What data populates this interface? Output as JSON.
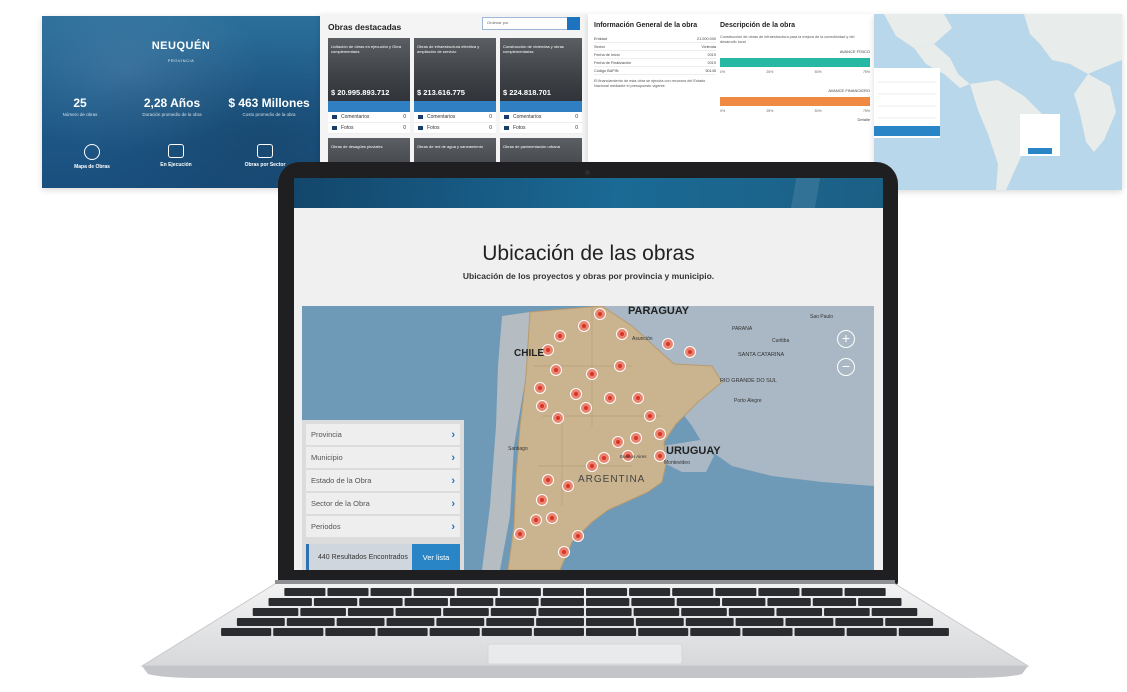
{
  "thumb_province": {
    "title": "NEUQUÉN",
    "subtitle": "PROVINCIA",
    "stats": [
      {
        "value": "25",
        "label": "Número de obras"
      },
      {
        "value": "2,28 Años",
        "label": "Duración promedio de la obra"
      },
      {
        "value": "$ 463 Millones",
        "label": "Costo promedio de la obra"
      }
    ],
    "nav": [
      "Mapa de Obras",
      "En Ejecución",
      "Obras por Sector"
    ]
  },
  "thumb_featured": {
    "title": "Obras destacadas",
    "order_placeholder": "Ordenar por",
    "cards": [
      {
        "text": "Licitación de obras en ejecución y Obra complementaria",
        "price": "$ 20.995.893.712"
      },
      {
        "text": "Obras de infraestructura eléctrica y ampliación de servicio",
        "price": "$ 213.616.775"
      },
      {
        "text": "Construcción de viviendas y obras complementarias",
        "price": "$ 224.818.701"
      }
    ],
    "row_labels": [
      "Comentarios",
      "Fotos"
    ],
    "row_counts": [
      "0",
      "0"
    ],
    "lower_cards": [
      "Obras de desagües pluviales",
      "Obras de red de agua y saneamiento",
      "Obras de pavimentación urbana"
    ]
  },
  "thumb_info": {
    "info_title": "Información General de la obra",
    "info_rows": [
      {
        "k": "Entidad",
        "v": "21.000.000"
      },
      {
        "k": "Sector",
        "v": "Vivienda"
      },
      {
        "k": "Fecha de Inicio",
        "v": "2019"
      },
      {
        "k": "Fecha de Finalización",
        "v": "2019"
      },
      {
        "k": "Código BAPIN",
        "v": "50145"
      }
    ],
    "info_note": "El financiamiento de esta obra se ejecuta con recursos del Estado Nacional mediante el presupuesto vigente",
    "desc_title": "Descripción de la obra",
    "desc_text": "Construcción de obras de infraestructura para la mejora de la conectividad y del desarrollo local",
    "avance_label": "AVANCE FÍSICO",
    "finance_label": "AVANCE FINANCIERO",
    "axis_ticks": [
      "0%",
      "25%",
      "50%",
      "75%"
    ],
    "bottom_label": "Detalle"
  },
  "thumb_map": {
    "filters": [
      "Provincia",
      "Municipio",
      "Estado de la Obra",
      "Sector de la Obra",
      "Periodos"
    ],
    "results": "440 Resultados Encontrados",
    "button": "Ver lista"
  },
  "screen": {
    "title": "Ubicación de las obras",
    "subtitle": "Ubicación de los proyectos y obras por provincia y municipio.",
    "map_labels": {
      "paraguay": "PARAGUAY",
      "chile": "CHILE",
      "uruguay": "URUGUAY",
      "argentina": "ARGENTINA",
      "parana": "PARANA",
      "santa_catarina": "SANTA CATARINA",
      "rio_grande": "RIO GRANDE DO SUL",
      "sao_paulo": "Sao Paulo",
      "curitiba": "Curitiba",
      "porto_alegre": "Porto Alegre",
      "asuncion": "Asunción",
      "santiago": "Santiago",
      "montevideo": "Montevideo",
      "buenos_aires": "Buenos Aires"
    },
    "filters": [
      "Provincia",
      "Municipio",
      "Estado de la Obra",
      "Sector de la Obra",
      "Periodos"
    ],
    "results_text": "440 Resultados Encontrados",
    "ver_lista": "Ver lista",
    "zoom_in": "+",
    "zoom_out": "−",
    "chevron": "›"
  },
  "colors": {
    "brand_blue": "#1e73be",
    "header_dark": "#13466b",
    "marker": "#e0463c",
    "land": "#c9b48f",
    "ocean": "#6e9ab8"
  }
}
